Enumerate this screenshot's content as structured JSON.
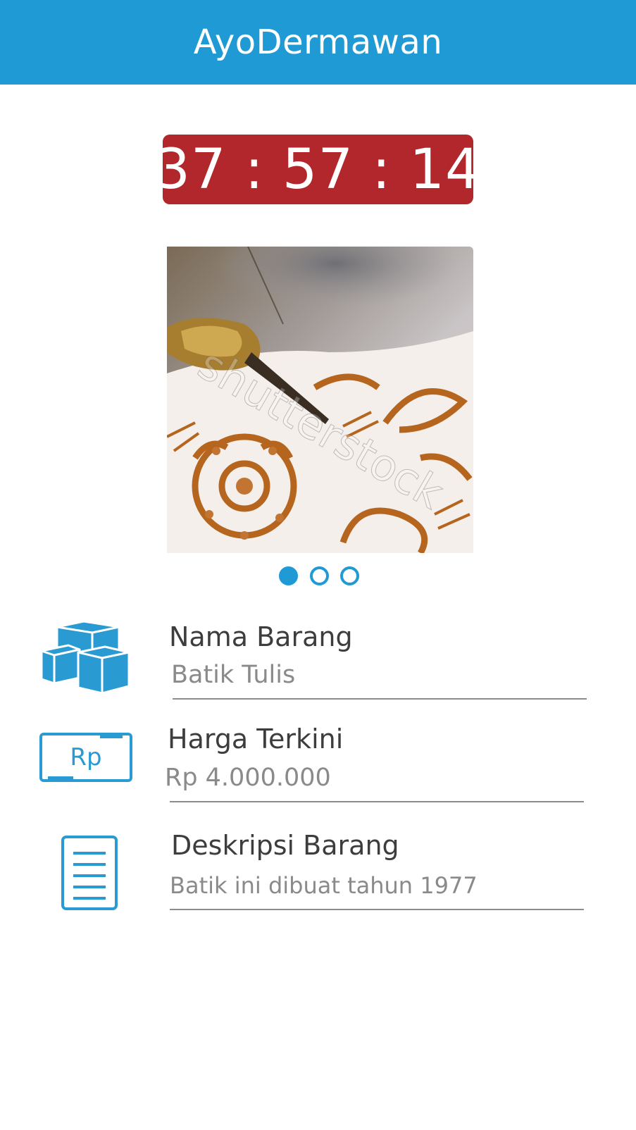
{
  "app_bar": {
    "title": "AyoDermawan",
    "color": "#1f9ad4"
  },
  "timer": {
    "hours": "37",
    "minutes": "57",
    "seconds": "14",
    "separator": ":",
    "color": "#b1272b"
  },
  "carousel": {
    "image": "batik-tulis-photo",
    "watermark": "shutterstock",
    "pages": 3,
    "active_index": 0
  },
  "fields": [
    {
      "icon": "boxes-icon",
      "label": "Nama Barang",
      "value": "Batik Tulis"
    },
    {
      "icon": "rupiah-icon",
      "icon_text": "Rp",
      "label": "Harga Terkini",
      "value": "Rp 4.000.000"
    },
    {
      "icon": "document-icon",
      "label": "Deskripsi Barang",
      "value": "Batik ini dibuat tahun 1977"
    }
  ]
}
